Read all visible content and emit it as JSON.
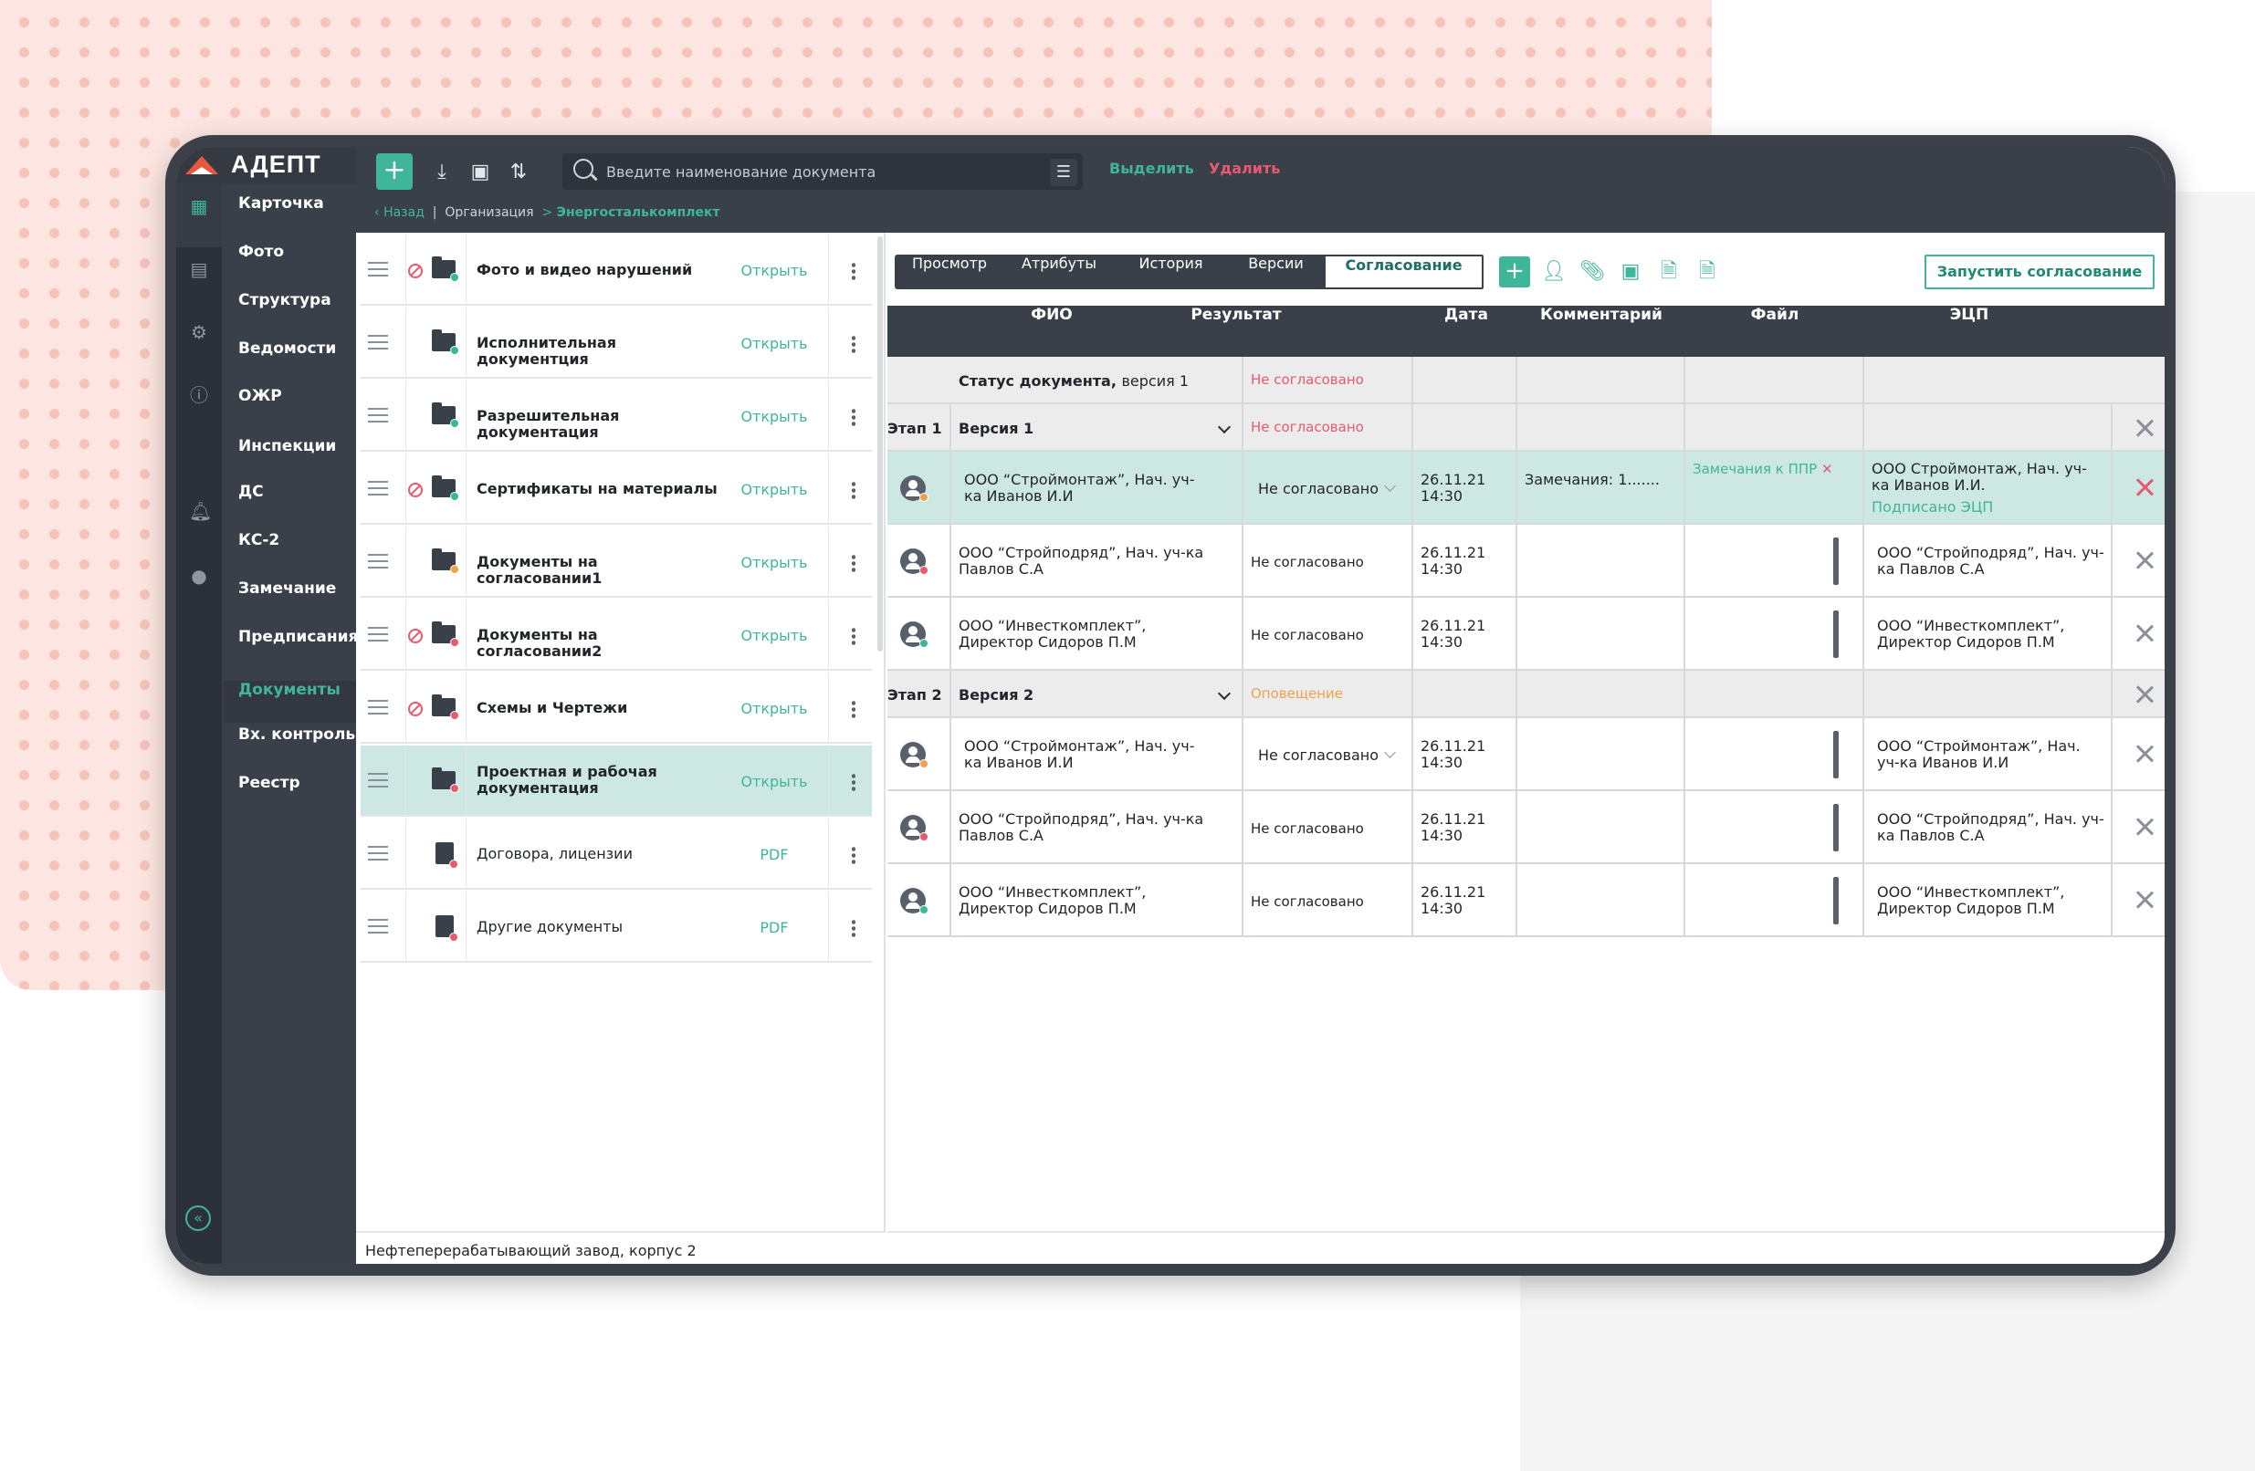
{
  "app": {
    "logo": "АДЕПТ"
  },
  "nav": {
    "items": [
      "Карточка",
      "Фото",
      "Структура",
      "Ведомости",
      "ОЖР",
      "Инспекции",
      "ДС",
      "КС-2",
      "Замечание",
      "Предписания",
      "Документы",
      "Вх. контроль",
      "Реестр"
    ],
    "active": "Документы"
  },
  "toolbar": {
    "add": "+",
    "search_placeholder": "Введите наименование документа",
    "select": "Выделить",
    "delete": "Удалить"
  },
  "breadcrumb": {
    "back": "Назад",
    "org": "Организация",
    "current": "Энергосталькомплект"
  },
  "folders": [
    {
      "name": "Фото и видео нарушений",
      "action": "Открыть",
      "blocked": true,
      "status": "green",
      "type": "folder"
    },
    {
      "name": "Исполнительная документция",
      "action": "Открыть",
      "blocked": false,
      "status": "green",
      "type": "folder"
    },
    {
      "name": "Разрешительная документация",
      "action": "Открыть",
      "blocked": false,
      "status": "green",
      "type": "folder"
    },
    {
      "name": "Сертификаты на материалы",
      "action": "Открыть",
      "blocked": true,
      "status": "green",
      "type": "folder"
    },
    {
      "name": "Документы на согласовании1",
      "action": "Открыть",
      "blocked": false,
      "status": "orange",
      "type": "folder"
    },
    {
      "name": "Документы на согласовании2",
      "action": "Открыть",
      "blocked": true,
      "status": "red",
      "type": "folder"
    },
    {
      "name": "Схемы и Чертежи",
      "action": "Открыть",
      "blocked": true,
      "status": "red",
      "type": "folder"
    },
    {
      "name": "Проектная и рабочая документация",
      "action": "Открыть",
      "blocked": false,
      "status": "red",
      "type": "folder",
      "selected": true
    },
    {
      "name": "Договора, лицензии",
      "action": "PDF",
      "blocked": false,
      "status": "red",
      "type": "doc"
    },
    {
      "name": "Другие документы",
      "action": "PDF",
      "blocked": false,
      "status": "red",
      "type": "doc"
    }
  ],
  "left_footer": "Нефтеперерабатывающий завод, корпус 2",
  "tabs": {
    "items": [
      "Просмотр",
      "Атрибуты",
      "История",
      "Версии",
      "Согласование"
    ],
    "active": "Согласование"
  },
  "start_button": "Запустить согласование",
  "table": {
    "headers": [
      "ФИО",
      "Результат",
      "Дата",
      "Комментарий",
      "Файл",
      "ЭЦП"
    ],
    "status_row": {
      "label": "Статус документа,",
      "version": "версия 1",
      "result": "Не согласовано"
    },
    "stages": [
      {
        "stage": "Этап 1",
        "version": "Версия 1",
        "result": "Не согласовано",
        "result_color": "red",
        "rows": [
          {
            "fio": "ООО “Строймонтаж”, Нач. уч-ка Иванов И.И",
            "result": "Не согласовано",
            "dropdown": true,
            "date": "26.11.21",
            "time": "14:30",
            "comment": "Замечания: 1.......",
            "file": "Замечания к ППР",
            "ecp": "ООО Строймонтаж, Нач. уч-ка Иванов И.И.",
            "ecp_status": "Подписано ЭЦП",
            "status": "orange",
            "highlight": true
          },
          {
            "fio": "ООО “Стройподряд”, Нач. уч-ка Павлов С.А",
            "result": "Не согласовано",
            "dropdown": false,
            "date": "26.11.21",
            "time": "14:30",
            "comment": "",
            "file": "",
            "ecp": "ООО “Стройподряд”, Нач. уч-ка Павлов С.А",
            "ecp_status": "",
            "status": "red",
            "highlight": false
          },
          {
            "fio": "ООО “Инвесткомплект”, Директор Сидоров П.М",
            "result": "Не согласовано",
            "dropdown": false,
            "date": "26.11.21",
            "time": "14:30",
            "comment": "",
            "file": "",
            "ecp": "ООО “Инвесткомплект”, Директор Сидоров П.М",
            "ecp_status": "",
            "status": "green",
            "highlight": false
          }
        ]
      },
      {
        "stage": "Этап 2",
        "version": "Версия 2",
        "result": "Оповещение",
        "result_color": "orange",
        "rows": [
          {
            "fio": "ООО “Строймонтаж”, Нач. уч-ка Иванов И.И",
            "result": "Не согласовано",
            "dropdown": true,
            "date": "26.11.21",
            "time": "14:30",
            "comment": "",
            "file": "",
            "ecp": "ООО “Строймонтаж”, Нач. уч-ка Иванов И.И",
            "ecp_status": "",
            "status": "orange",
            "highlight": false
          },
          {
            "fio": "ООО “Стройподряд”, Нач. уч-ка Павлов С.А",
            "result": "Не согласовано",
            "dropdown": false,
            "date": "26.11.21",
            "time": "14:30",
            "comment": "",
            "file": "",
            "ecp": "ООО “Стройподряд”, Нач. уч-ка Павлов С.А",
            "ecp_status": "",
            "status": "red",
            "highlight": false
          },
          {
            "fio": "ООО “Инвесткомплект”, Директор Сидоров П.М",
            "result": "Не согласовано",
            "dropdown": false,
            "date": "26.11.21",
            "time": "14:30",
            "comment": "",
            "file": "",
            "ecp": "ООО “Инвесткомплект”, Директор Сидоров П.М",
            "ecp_status": "",
            "status": "green",
            "highlight": false
          }
        ]
      }
    ]
  },
  "colors": {
    "accent": "#3fb59a",
    "danger": "#e8596e",
    "warning": "#f0a24b",
    "dark": "#3a4049"
  }
}
